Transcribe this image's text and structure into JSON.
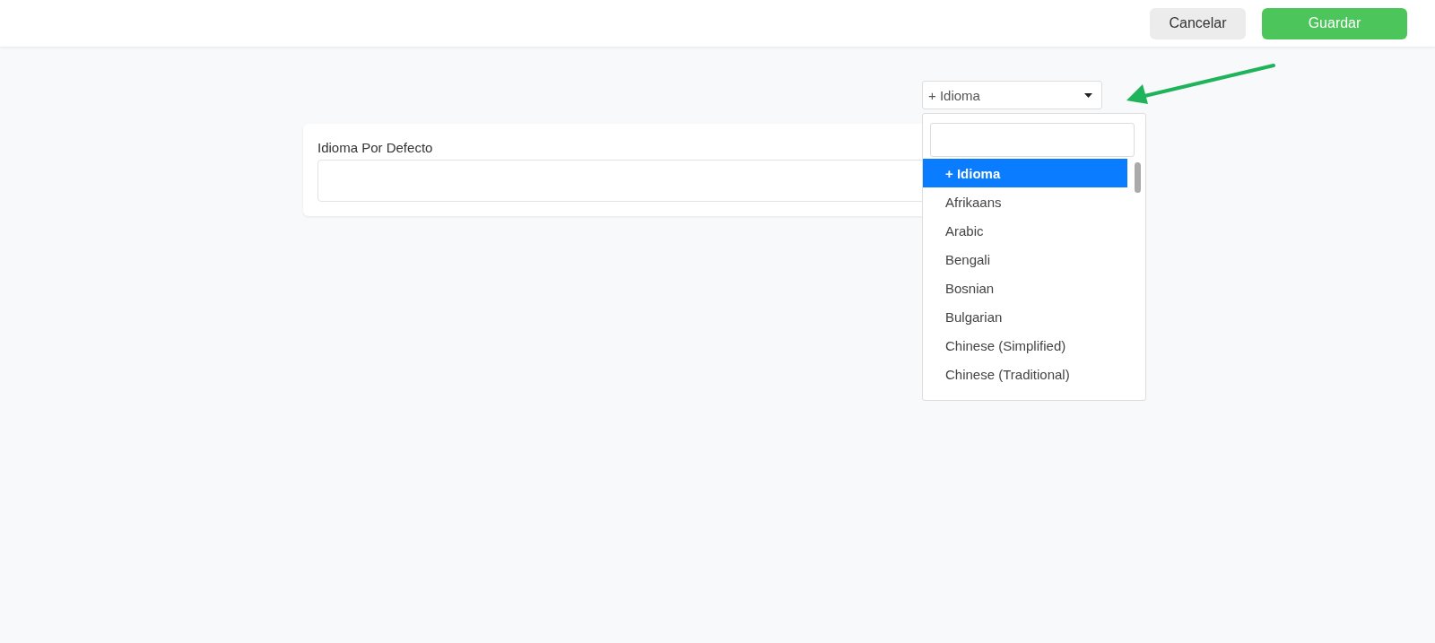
{
  "header": {
    "buttons": [
      {
        "label": "Cancelar",
        "kind": "secondary"
      },
      {
        "label": "Guardar",
        "kind": "primary"
      }
    ]
  },
  "language_select": {
    "value": "+ Idioma",
    "expanded": true,
    "options": [
      {
        "label": "+ Idioma",
        "selected": true
      },
      {
        "label": "Afrikaans",
        "selected": false
      },
      {
        "label": "Arabic",
        "selected": false
      },
      {
        "label": "Bengali",
        "selected": false
      },
      {
        "label": "Bosnian",
        "selected": false
      },
      {
        "label": "Bulgarian",
        "selected": false
      },
      {
        "label": "Chinese (Simplified)",
        "selected": false
      },
      {
        "label": "Chinese (Traditional)",
        "selected": false
      }
    ]
  },
  "card": {
    "label": "Idioma Por Defecto"
  }
}
